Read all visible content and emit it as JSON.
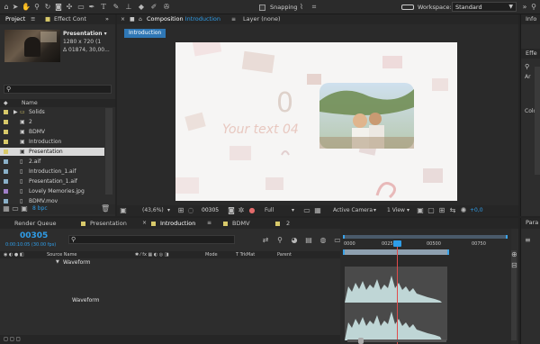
{
  "toolbar": {
    "snapping_label": "Snapping",
    "workspace_label": "Workspace:",
    "workspace_value": "Standard",
    "colors": {
      "bg": "#2b2b2b",
      "accent": "#2f9de8"
    }
  },
  "project_panel": {
    "tab_project": "Project",
    "tab_effect_controls": "Effect Cont",
    "preview": {
      "name": "Presentation ▾",
      "size": "1280 x 720 (1",
      "info": "Δ 01874, 30,00..."
    },
    "search_placeholder": "",
    "col_name": "Name",
    "items": [
      {
        "label": "Solids",
        "icon": "folder-icon",
        "color": "#d8c96a"
      },
      {
        "label": "2",
        "icon": "comp-icon",
        "color": "#d8c96a"
      },
      {
        "label": "BDMV",
        "icon": "comp-icon",
        "color": "#d8c96a"
      },
      {
        "label": "Introduction",
        "icon": "comp-icon",
        "color": "#d8c96a"
      },
      {
        "label": "Presentation",
        "icon": "comp-icon",
        "color": "#d8c96a"
      },
      {
        "label": "2.aif",
        "icon": "file-icon",
        "color": "#8ab0c8"
      },
      {
        "label": "Introduction_1.aif",
        "icon": "file-icon",
        "color": "#8ab0c8"
      },
      {
        "label": "Presentation_1.aif",
        "icon": "file-icon",
        "color": "#8ab0c8"
      },
      {
        "label": "Lovely Memories.jpg",
        "icon": "file-icon",
        "color": "#a07fc8"
      },
      {
        "label": "BDMV.mov",
        "icon": "file-icon",
        "color": "#8ab0c8"
      }
    ],
    "bpc": "8 bpc"
  },
  "composition_panel": {
    "tab_composition": "Composition",
    "tab_composition_name": "Introduction",
    "tab_layer": "Layer (none)",
    "breadcrumb": "Introduction",
    "canvas_text": "Your text 04",
    "footer": {
      "zoom": "(43,6%)",
      "timecode": "00305",
      "resolution": "Full",
      "camera": "Active Camera",
      "views": "1 View",
      "exposure": "+0,0"
    }
  },
  "right_panel": {
    "info_tab": "Info",
    "effects_tab": "Effe",
    "ar_label": "Ar",
    "co_label": "Colo",
    "para_tab": "Para"
  },
  "timeline": {
    "tabs": [
      "Render Queue",
      "Presentation",
      "Introduction",
      "BDMV",
      "2"
    ],
    "active_tab": "Introduction",
    "timecode": "00305",
    "timecode_sub": "0:00:10:05 (30.00 fps)",
    "columns": {
      "source_name": "Source Name",
      "mode": "Mode",
      "trkmat": "T  TrkMat",
      "parent": "Parent"
    },
    "waveform_label": "Waveform",
    "waveform_text": "Waveform",
    "ruler": [
      "0000",
      "00250",
      "00500",
      "00750"
    ],
    "footer_icons": "toggle-switches"
  }
}
